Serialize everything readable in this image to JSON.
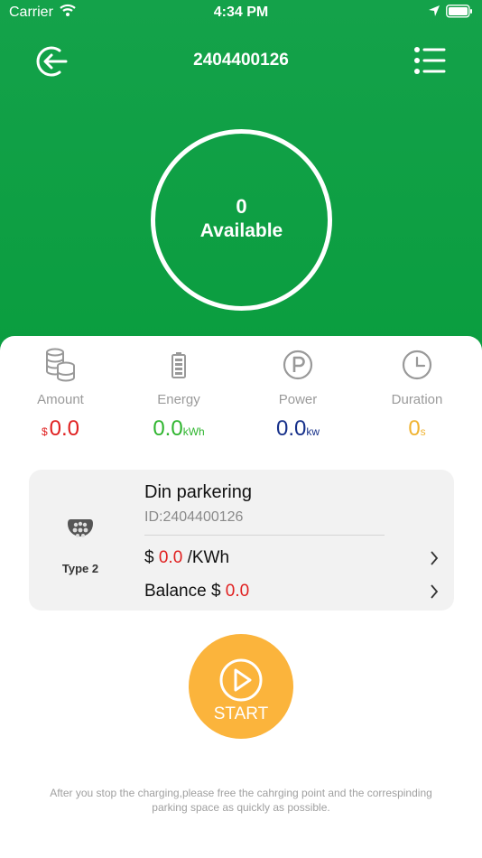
{
  "status_bar": {
    "carrier": "Carrier",
    "time": "4:34 PM"
  },
  "nav": {
    "title": "2404400126",
    "back_icon": "logout-arrow-icon",
    "menu_icon": "list-menu-icon"
  },
  "charger": {
    "number": "0",
    "status": "Available"
  },
  "stats": {
    "amount": {
      "label": "Amount",
      "prefix": "$",
      "value": "0.0",
      "color": "#e02020"
    },
    "energy": {
      "label": "Energy",
      "value": "0.0",
      "unit": "kWh",
      "color": "#2fb52f"
    },
    "power": {
      "label": "Power",
      "value": "0.0",
      "unit": "kw",
      "color": "#16308a"
    },
    "duration": {
      "label": "Duration",
      "value": "0",
      "unit": "s",
      "color": "#f0b331"
    }
  },
  "connector": {
    "type_label": "Type 2",
    "name": "Din parkering",
    "id": "ID:2404400126",
    "price_prefix": "$",
    "price_value": "0.0",
    "price_unit": "/KWh",
    "balance_label": "Balance $",
    "balance_value": "0.0"
  },
  "start_button": {
    "label": "START"
  },
  "footer": {
    "note": "After you stop the charging,please free the cahrging point and the correspinding parking space as quickly as possible."
  },
  "colors": {
    "header_green": "#0a9d3f",
    "start_orange": "#fbb43c",
    "red": "#e02020"
  }
}
